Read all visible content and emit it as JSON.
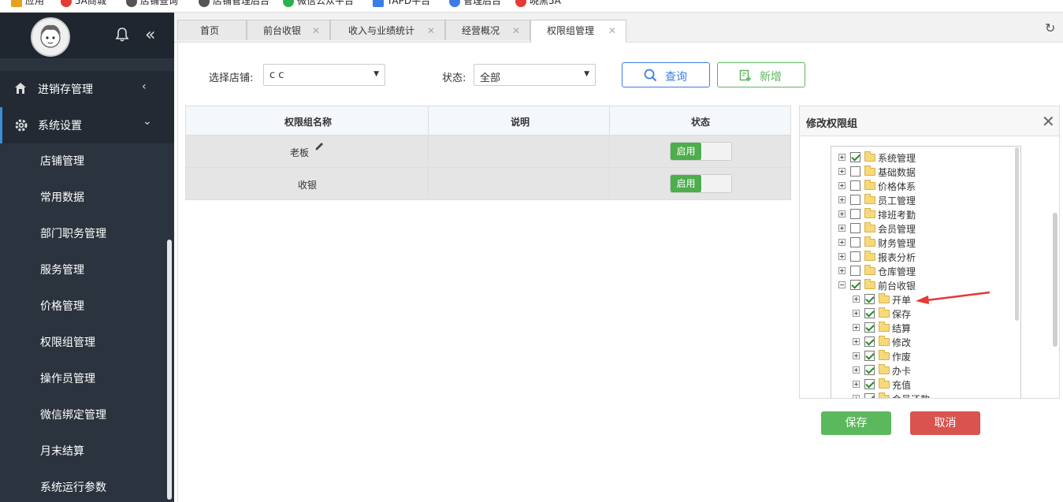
{
  "bookmarks": [
    {
      "label": "应用",
      "color": "#e8a020"
    },
    {
      "label": "5A商城",
      "color": "#e53935"
    },
    {
      "label": "店铺查询",
      "color": "#555555"
    },
    {
      "label": "店铺管理后台",
      "color": "#555555"
    },
    {
      "label": "微信公众平台",
      "color": "#2bb24c"
    },
    {
      "label": "TAPD平台",
      "color": "#3b7de8"
    },
    {
      "label": "管理后台",
      "color": "#3b7de8"
    },
    {
      "label": "晓黑5A",
      "color": "#e53935"
    }
  ],
  "sidebar": {
    "groups": [
      {
        "label": "进销存管理",
        "icon": "home-icon",
        "arrow": "‹"
      },
      {
        "label": "系统设置",
        "icon": "gear-icon",
        "arrow": "⌄"
      }
    ],
    "items": [
      "店铺管理",
      "常用数据",
      "部门职务管理",
      "服务管理",
      "价格管理",
      "权限组管理",
      "操作员管理",
      "微信绑定管理",
      "月末结算",
      "系统运行参数"
    ]
  },
  "tabs": [
    {
      "label": "首页",
      "closable": false
    },
    {
      "label": "前台收银",
      "closable": true
    },
    {
      "label": "收入与业绩统计",
      "closable": true
    },
    {
      "label": "经营概况",
      "closable": true
    },
    {
      "label": "权限组管理",
      "closable": true,
      "active": true
    }
  ],
  "filters": {
    "store_label": "选择店铺:",
    "store_value": "c c",
    "status_label": "状态:",
    "status_value": "全部",
    "query_label": "查询",
    "add_label": "新增"
  },
  "table": {
    "columns": [
      "权限组名称",
      "说明",
      "状态"
    ],
    "rows": [
      {
        "name": "老板",
        "desc": "",
        "status": "启用"
      },
      {
        "name": "收银",
        "desc": "",
        "status": "启用"
      }
    ]
  },
  "panel": {
    "title": "修改权限组",
    "tree": [
      {
        "label": "系统管理",
        "checked": true,
        "level": 0,
        "expanded": false
      },
      {
        "label": "基础数据",
        "checked": false,
        "level": 0,
        "expanded": false
      },
      {
        "label": "价格体系",
        "checked": false,
        "level": 0,
        "expanded": false
      },
      {
        "label": "员工管理",
        "checked": false,
        "level": 0,
        "expanded": false
      },
      {
        "label": "排班考勤",
        "checked": false,
        "level": 0,
        "expanded": false
      },
      {
        "label": "会员管理",
        "checked": false,
        "level": 0,
        "expanded": false
      },
      {
        "label": "财务管理",
        "checked": false,
        "level": 0,
        "expanded": false
      },
      {
        "label": "报表分析",
        "checked": false,
        "level": 0,
        "expanded": false
      },
      {
        "label": "仓库管理",
        "checked": false,
        "level": 0,
        "expanded": false
      },
      {
        "label": "前台收银",
        "checked": true,
        "level": 0,
        "expanded": true
      },
      {
        "label": "开单",
        "checked": true,
        "level": 1,
        "expanded": false
      },
      {
        "label": "保存",
        "checked": true,
        "level": 1,
        "expanded": false
      },
      {
        "label": "结算",
        "checked": true,
        "level": 1,
        "expanded": false
      },
      {
        "label": "修改",
        "checked": true,
        "level": 1,
        "expanded": false
      },
      {
        "label": "作废",
        "checked": true,
        "level": 1,
        "expanded": false
      },
      {
        "label": "办卡",
        "checked": true,
        "level": 1,
        "expanded": false
      },
      {
        "label": "充值",
        "checked": true,
        "level": 1,
        "expanded": false
      },
      {
        "label": "会员还款",
        "checked": true,
        "level": 1,
        "expanded": false
      }
    ],
    "save_label": "保存",
    "cancel_label": "取消"
  },
  "colors": {
    "sidebar_bg": "#2b333e",
    "primary": "#337ab7",
    "success": "#5cb85c",
    "danger": "#d9534f",
    "annotation_arrow": "#e53935"
  }
}
